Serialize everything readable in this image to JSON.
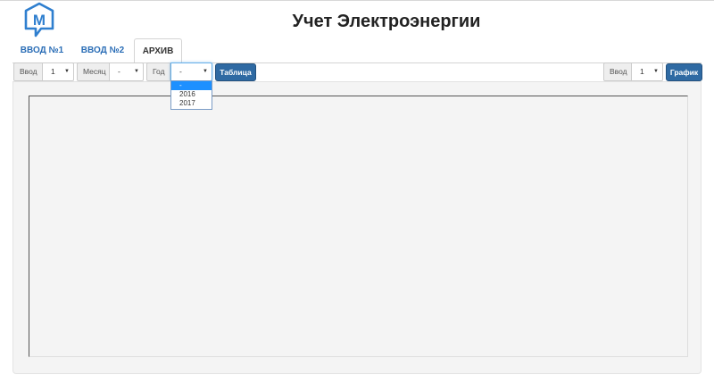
{
  "header": {
    "title": "Учет Электроэнергии",
    "logo_letter": "M",
    "brand_color": "#2f7fcf"
  },
  "tabs": [
    {
      "label": "ВВОД №1",
      "active": false
    },
    {
      "label": "ВВОД №2",
      "active": false
    },
    {
      "label": "АРХИВ",
      "active": true
    }
  ],
  "toolbar": {
    "input_label": "Ввод",
    "input_value": "1",
    "month_label": "Месяц",
    "month_value": "-",
    "year_label": "Год",
    "year_value": "-",
    "table_button": "Таблица",
    "right_input_label": "Ввод",
    "right_input_value": "1",
    "graph_button": "График"
  },
  "year_dropdown": {
    "options": [
      "-",
      "2016",
      "2017"
    ],
    "selected_index": 0
  },
  "icons": {
    "caret": "caret-down-icon"
  }
}
